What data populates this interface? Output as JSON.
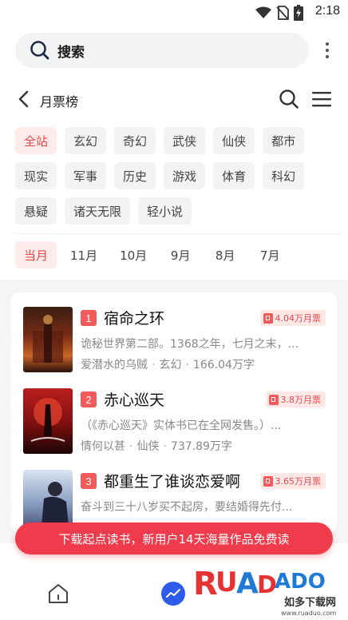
{
  "status_bar": {
    "time": "2:18"
  },
  "search": {
    "label": "搜索"
  },
  "header": {
    "title": "月票榜"
  },
  "filters": {
    "row1": [
      "全站",
      "玄幻",
      "奇幻",
      "武侠",
      "仙侠",
      "都市"
    ],
    "row2": [
      "现实",
      "军事",
      "历史",
      "游戏",
      "体育",
      "科幻"
    ],
    "row3": [
      "悬疑",
      "诸天无限",
      "轻小说"
    ],
    "active": "全站"
  },
  "months": [
    "当月",
    "11月",
    "10月",
    "9月",
    "8月",
    "7月"
  ],
  "books": [
    {
      "rank": "1",
      "title": "宿命之环",
      "votes": "4.04万月票",
      "desc": "诡秘世界第二部。1368之年，七月之末，...",
      "author": "爱潜水的乌贼",
      "genre": "玄幻",
      "words": "166.04万字"
    },
    {
      "rank": "2",
      "title": "赤心巡天",
      "votes": "3.8万月票",
      "desc": "（《赤心巡天》实体书已在全网发售。）...",
      "author": "情何以甚",
      "genre": "仙侠",
      "words": "737.89万字"
    },
    {
      "rank": "3",
      "title": "都重生了谁谈恋爱啊",
      "votes": "3.65万月票",
      "desc": "奋斗到三十八岁买不起房，要结婚得先付...",
      "author": "",
      "genre": "",
      "words": ""
    }
  ],
  "banner": {
    "text": "下载起点读书，新用户14天海量作品免费读"
  },
  "watermark": {
    "brand": "RUANDADO",
    "tagline": "如多下载网",
    "url": "www.ruaduo.com"
  },
  "colors": {
    "accent": "#e8474a",
    "banner": "#ef3b4b",
    "chip_bg": "#f3f3f3",
    "active_chip_bg": "#fdeceb",
    "nav_blue": "#2f5bea"
  }
}
